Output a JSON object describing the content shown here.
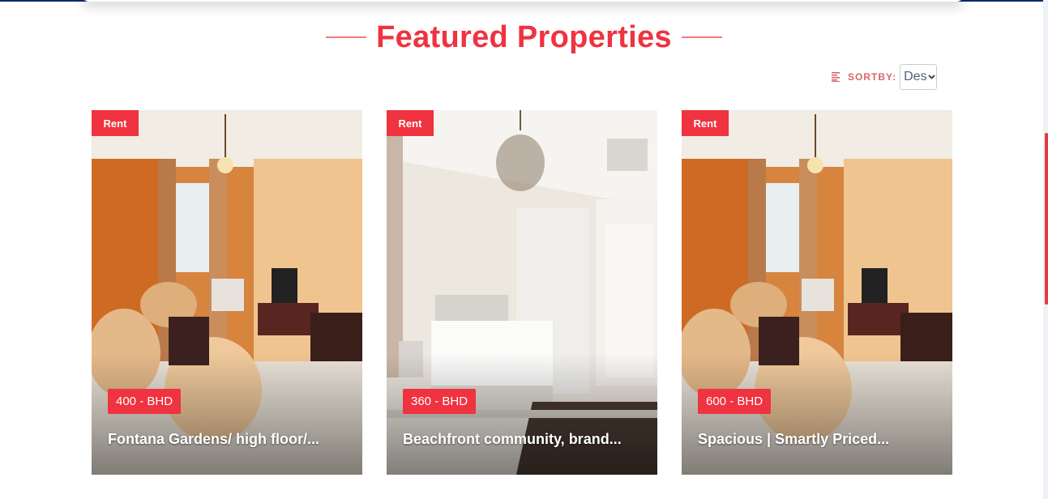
{
  "section": {
    "title": "Featured Properties"
  },
  "sort": {
    "label": "SORTBY:",
    "selected": "Desc"
  },
  "colors": {
    "accent": "#ef3340",
    "top_bar": "#0a2a6b"
  },
  "icons": {
    "sort": "sort-lines-icon",
    "dropdown": "chevron-down-icon"
  },
  "properties": [
    {
      "badge": "Rent",
      "price": "400 - BHD",
      "title": "Fontana Gardens/ high floor/...",
      "image": "living-room-orange-walls"
    },
    {
      "badge": "Rent",
      "price": "360 - BHD",
      "title": "Beachfront community, brand...",
      "image": "bedroom-chandelier"
    },
    {
      "badge": "Rent",
      "price": "600 - BHD",
      "title": "Spacious | Smartly Priced...",
      "image": "living-room-orange-walls"
    }
  ]
}
